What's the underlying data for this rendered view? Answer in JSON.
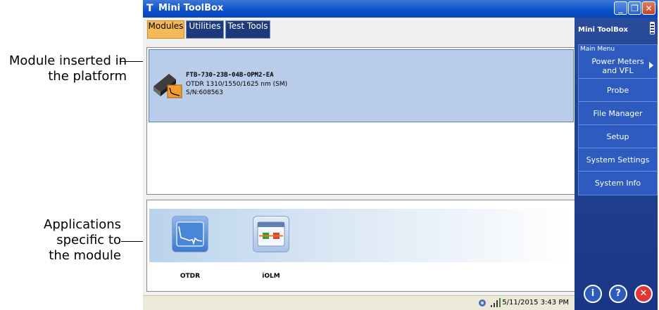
{
  "callouts": {
    "module": [
      "Module inserted in",
      "the platform"
    ],
    "apps": [
      "Applications",
      "specific to",
      "the module"
    ]
  },
  "window": {
    "app_icon": "T",
    "title": "Mini ToolBox",
    "controls": {
      "minimize": "_",
      "maximize": "❐",
      "close": "✕"
    }
  },
  "tabs": [
    {
      "label": "Modules",
      "active": true
    },
    {
      "label": "Utilities",
      "active": false
    },
    {
      "label": "Test Tools",
      "active": false
    }
  ],
  "module": {
    "name": "FTB-730-23B-04B-OPM2-EA",
    "description": "OTDR 1310/1550/1625 nm (SM)",
    "serial": "S/N:608563"
  },
  "applications": [
    {
      "label": "OTDR",
      "icon": "otdr-trace-icon"
    },
    {
      "label": "iOLM",
      "icon": "iolm-link-icon"
    }
  ],
  "statusbar": {
    "icons": [
      "network-icon",
      "signal-strength-icon"
    ],
    "datetime": "5/11/2015 3:43 PM"
  },
  "sidebar": {
    "title": "Mini ToolBox",
    "menu_caption": "Main Menu",
    "items": [
      {
        "label": "Power Meters and VFL",
        "has_submenu": true
      },
      {
        "label": "Probe",
        "has_submenu": false
      },
      {
        "label": "File Manager",
        "has_submenu": false
      },
      {
        "label": "Setup",
        "has_submenu": false
      },
      {
        "label": "System Settings",
        "has_submenu": false
      },
      {
        "label": "System Info",
        "has_submenu": false
      }
    ],
    "bottom_buttons": [
      {
        "name": "info",
        "glyph": "i",
        "color": "#2d5bbf"
      },
      {
        "name": "help",
        "glyph": "?",
        "color": "#2d5bbf"
      },
      {
        "name": "exit",
        "glyph": "✕",
        "color": "#e0383a"
      }
    ]
  },
  "colors": {
    "titlebar": "#0a4fc9",
    "active_tab": "#f7b955",
    "inactive_tab": "#1e3a7a",
    "selected_row": "#b9cdeb",
    "sidebar": "#1a3686",
    "close_button": "#e0383a"
  }
}
